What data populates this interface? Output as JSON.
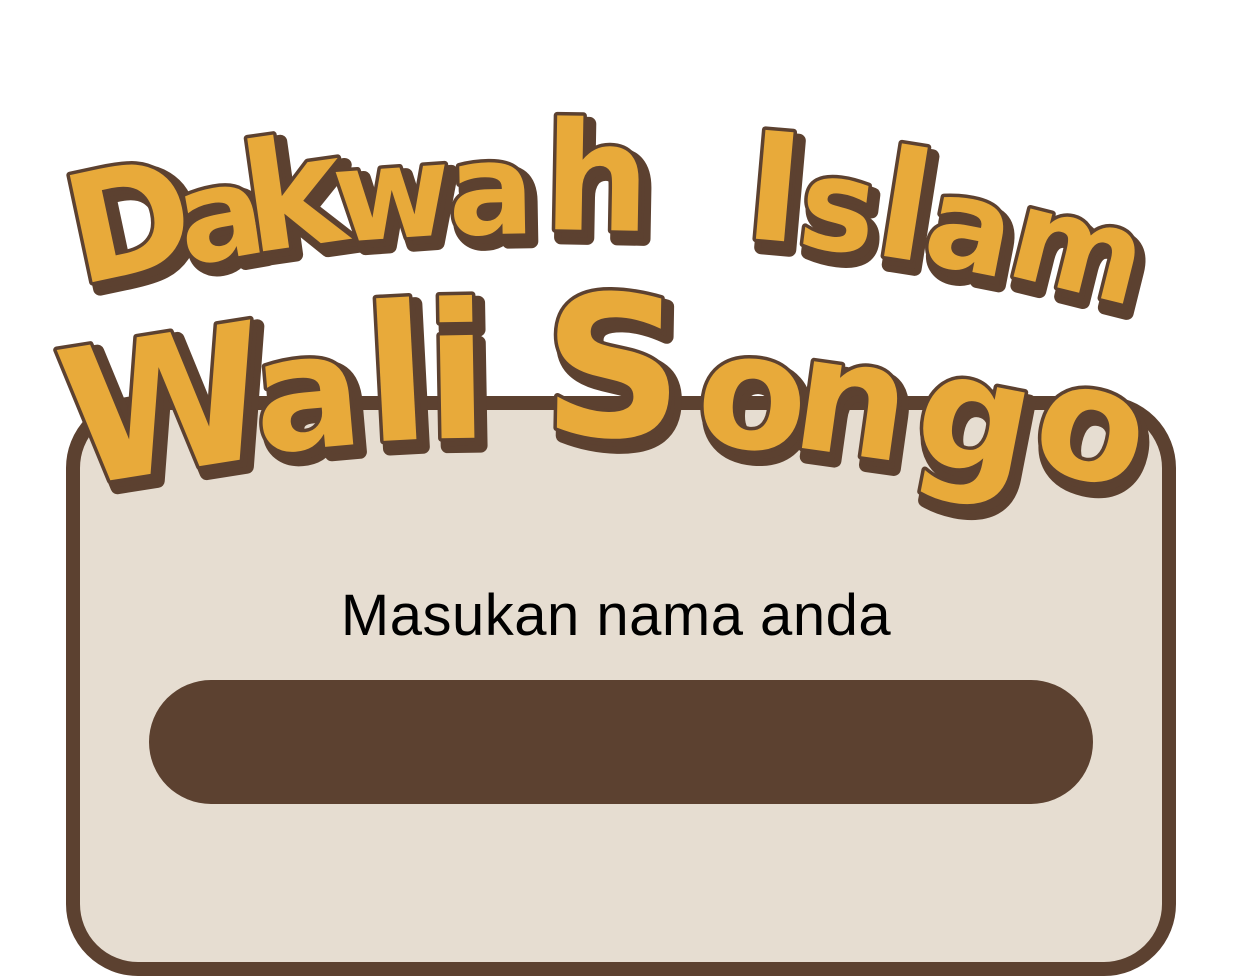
{
  "title": {
    "line1": {
      "letters": [
        "D",
        "a",
        "k",
        "w",
        "a",
        "h",
        " ",
        "I",
        "s",
        "l",
        "a",
        "m"
      ]
    },
    "line2": {
      "letters": [
        "W",
        "a",
        "l",
        "i",
        " ",
        "S",
        "o",
        "n",
        "g",
        "o"
      ]
    }
  },
  "form": {
    "prompt_label": "Masukan nama anda",
    "name_input_value": "",
    "name_input_placeholder": ""
  },
  "colors": {
    "background": "#ffffff",
    "card_fill": "#e6ddd1",
    "brown": "#5c4130",
    "title_fill": "#e8aa3a",
    "text": "#000000"
  }
}
